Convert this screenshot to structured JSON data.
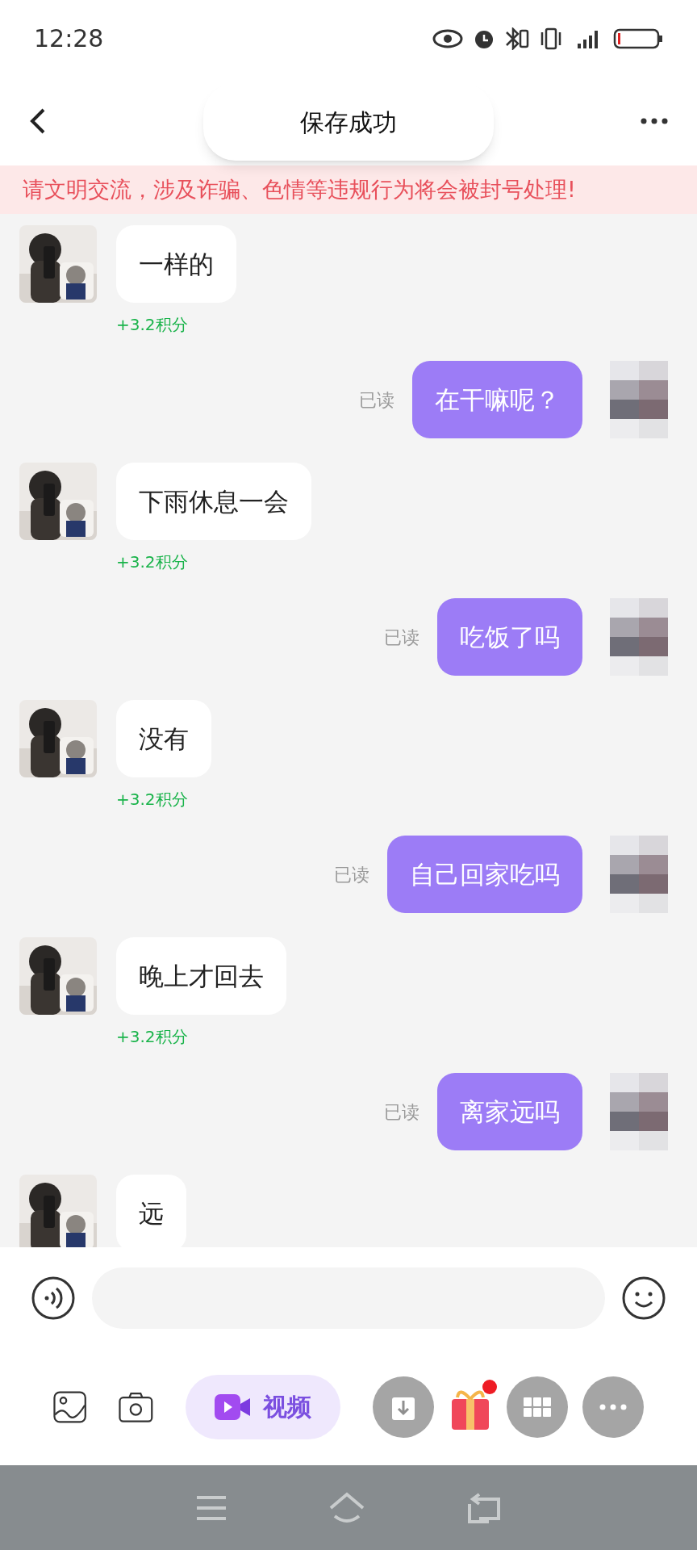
{
  "status_bar": {
    "time": "12:28"
  },
  "toast": {
    "text": "保存成功"
  },
  "notice": "请文明交流，涉及诈骗、色情等违规行为将会被封号处理!",
  "messages": [
    {
      "kind": "received",
      "text": "一样的",
      "points": "+3.2积分"
    },
    {
      "kind": "sent",
      "text": "在干嘛呢？",
      "read": "已读"
    },
    {
      "kind": "received",
      "text": "下雨休息一会",
      "points": "+3.2积分"
    },
    {
      "kind": "sent",
      "text": "吃饭了吗",
      "read": "已读"
    },
    {
      "kind": "received",
      "text": "没有",
      "points": "+3.2积分"
    },
    {
      "kind": "sent",
      "text": "自己回家吃吗",
      "read": "已读"
    },
    {
      "kind": "received",
      "text": "晚上才回去",
      "points": "+3.2积分"
    },
    {
      "kind": "sent",
      "text": "离家远吗",
      "read": "已读"
    },
    {
      "kind": "received",
      "text": "远"
    }
  ],
  "toolbar": {
    "video_label": "视频",
    "gift_has_notification": true
  }
}
